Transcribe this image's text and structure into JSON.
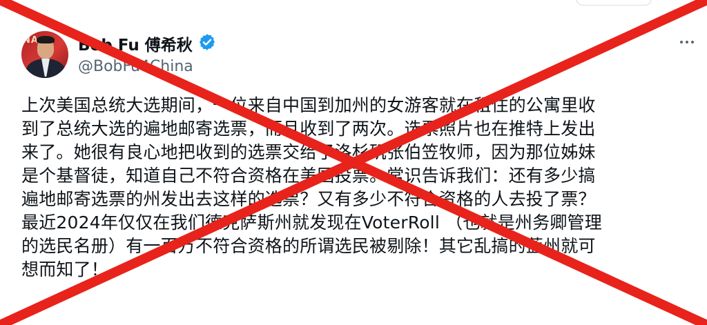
{
  "author": {
    "display_name": "Bob Fu 傅希秋",
    "handle": "@BobFu4China",
    "avatar_backdrop_text": "NA"
  },
  "icons": {
    "verified": "verified-badge-icon",
    "more": "more-options-icon",
    "overlay": "red-cross-mark"
  },
  "tweet": {
    "lines": [
      "上次美国总统大选期间，一位来自中国到加州的女游客就在租住的公寓里收",
      "到了总统大选的遍地邮寄选票，而且收到了两次。选票照片也在推特上发出",
      "来了。她很有良心地把收到的选票交给了洛杉矶张伯笠牧师，因为那位姊妹",
      "是个基督徒，知道自己不符合资格在美国投票。常识告诉我们：还有多少搞",
      "遍地邮寄选票的州发出去这样的选票？又有多少不符合资格的人去投了票？",
      "最近2024年仅仅在我们德克萨斯州就发现在VoterRoll （也就是州务卿管理",
      "的选民名册）有一百万不符合资格的所谓选民被剔除！其它乱搞的蓝州就可",
      "想而知了！"
    ]
  },
  "colors": {
    "cross": "#e8231b",
    "verified": "#1d9bf0",
    "text": "#0f1419",
    "secondary": "#536471"
  }
}
